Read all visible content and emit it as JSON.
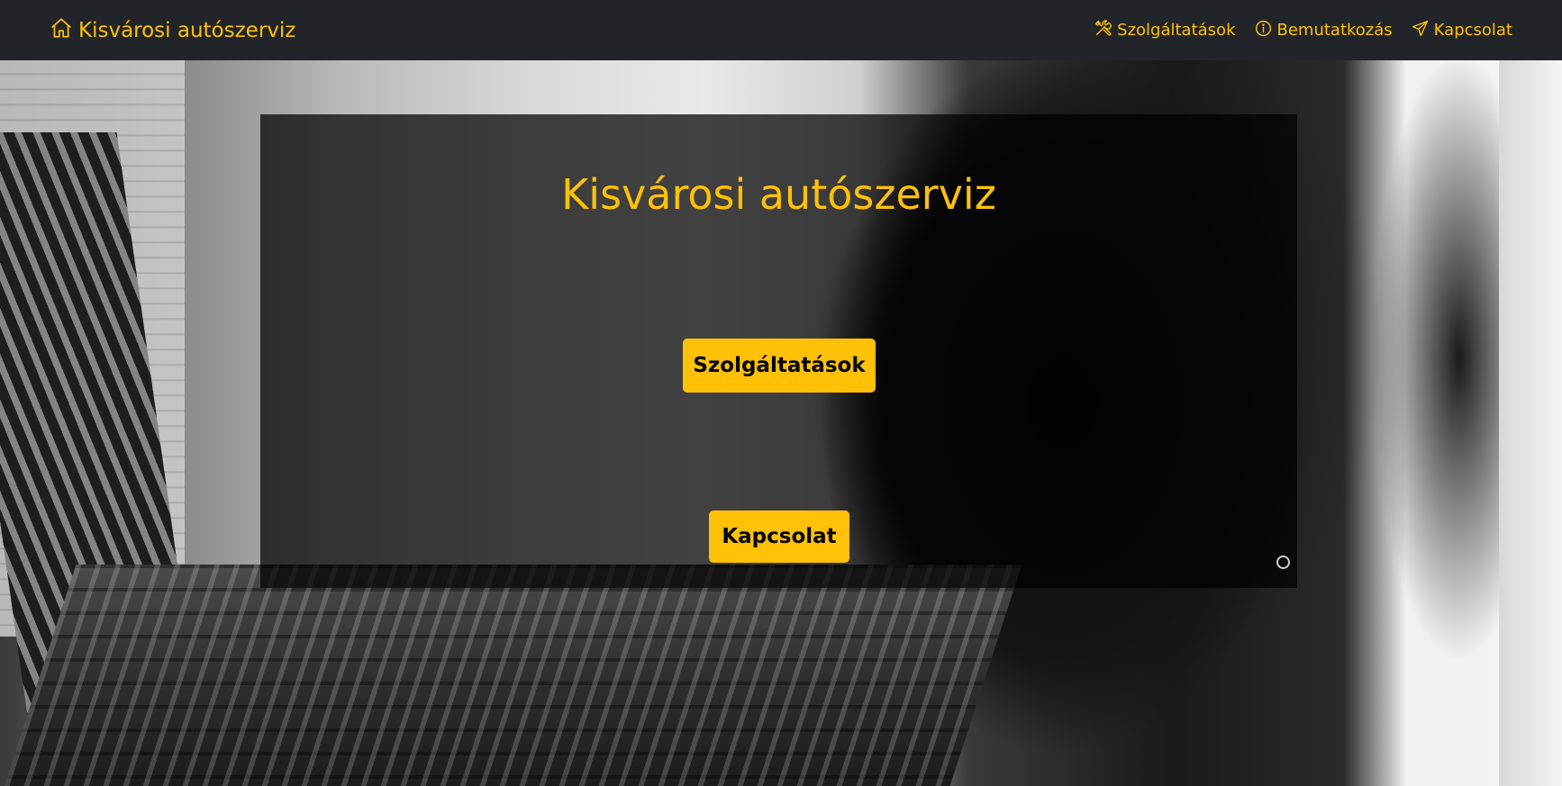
{
  "navbar": {
    "brand": "Kisvárosi autószerviz",
    "links": [
      {
        "label": "Szolgáltatások",
        "icon": "tools-icon"
      },
      {
        "label": "Bemutatkozás",
        "icon": "info-circle-icon"
      },
      {
        "label": "Kapcsolat",
        "icon": "send-icon"
      }
    ]
  },
  "hero": {
    "title": "Kisvárosi autószerviz",
    "services_button": "Szolgáltatások",
    "contact_button": "Kapcsolat"
  },
  "colors": {
    "accent": "#ffc107",
    "navbar_bg": "#212529"
  }
}
